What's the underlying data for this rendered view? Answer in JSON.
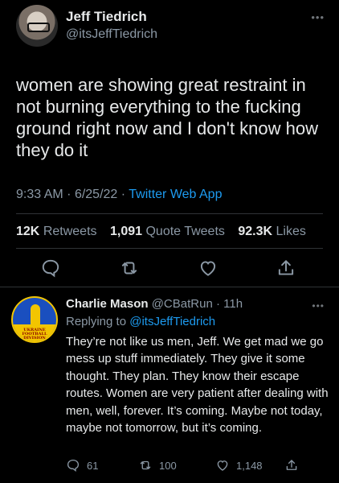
{
  "tweet": {
    "author_name": "Jeff Tiedrich",
    "author_handle": "@itsJeffTiedrich",
    "more_icon": "more-icon",
    "text": "women are showing great restraint in not burning everything to the fucking ground right now and I don't know how they do it",
    "time": "9:33 AM",
    "date": "6/25/22",
    "separator": "·",
    "app": "Twitter Web App",
    "stats": {
      "retweets_count": "12K",
      "retweets_label": "Retweets",
      "quotes_count": "1,091",
      "quotes_label": "Quote Tweets",
      "likes_count": "92.3K",
      "likes_label": "Likes"
    },
    "actions": [
      "reply-icon",
      "retweet-icon",
      "like-icon",
      "share-icon"
    ]
  },
  "reply": {
    "author_name": "Charlie Mason",
    "author_handle": "@CBatRun",
    "separator": "·",
    "time": "11h",
    "replying_label": "Replying to",
    "replying_to": "@itsJeffTiedrich",
    "avatar_text": "UKRAINE FOOTBALL DIVISION",
    "text": "They’re not like us men, Jeff. We get mad we go mess up stuff immediately. They give it some thought. They plan. They know their escape routes. Women are very patient after dealing with men, well, forever. It’s coming. Maybe not today, maybe not tomorrow, but it’s coming.",
    "replies": "61",
    "retweets": "100",
    "likes": "1,148"
  },
  "colors": {
    "background": "#000000",
    "text": "#e7e9ea",
    "muted": "#8b98a5",
    "link": "#1d9bf0",
    "divider": "#2f3336"
  }
}
